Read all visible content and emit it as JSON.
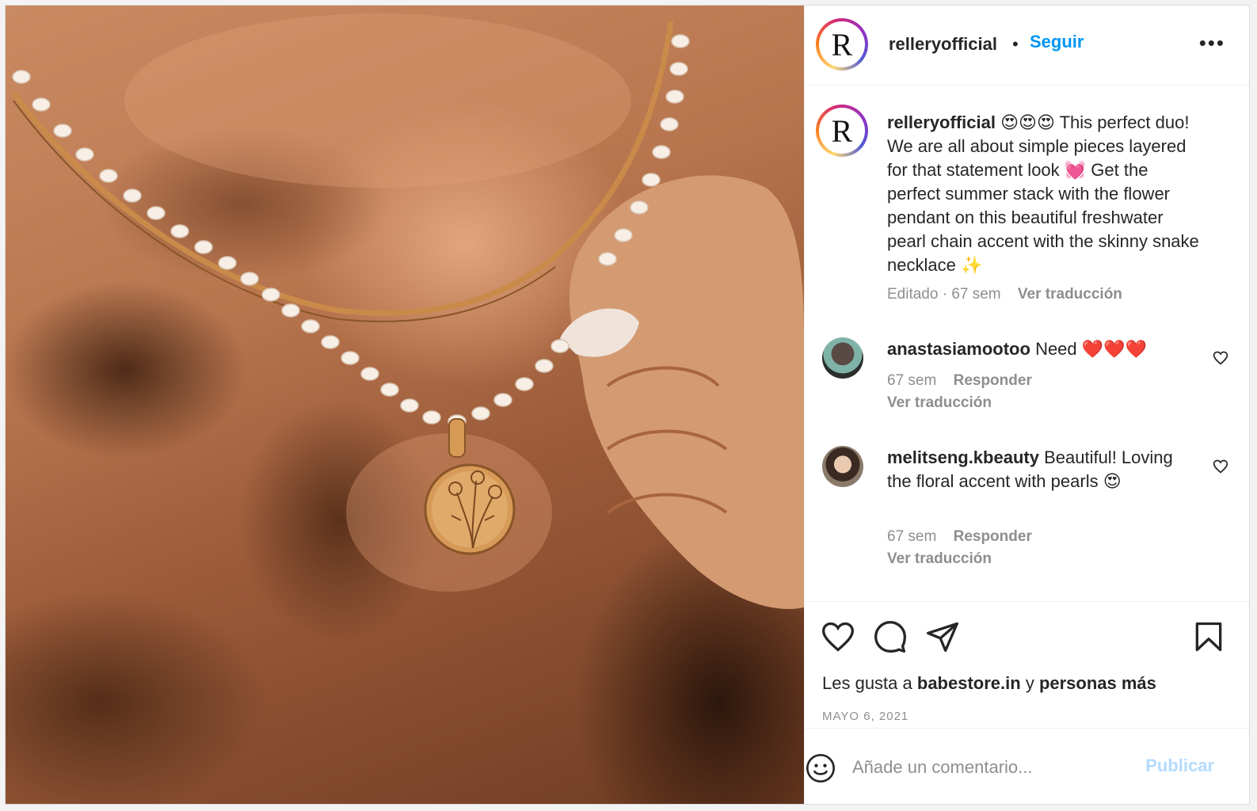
{
  "post": {
    "image_alt": "Woman wearing layered pearl and gold snake chain necklaces with floral pendant"
  },
  "header": {
    "avatar_letter": "R",
    "username": "relleryofficial",
    "separator": "•",
    "follow_label": "Seguir",
    "more_label": "•••"
  },
  "caption": {
    "avatar_letter": "R",
    "username": "relleryofficial",
    "emojis": "😍😍😍",
    "text": "This perfect duo! We are all about simple pieces layered for that statement look 💓 Get the perfect summer stack with the flower pendant on this beautiful freshwater pearl chain accent with the skinny snake necklace ✨",
    "edited_time": "Editado · 67 sem",
    "translate": "Ver traducción"
  },
  "comments": [
    {
      "username": "anastasiamootoo",
      "text": "Need ❤️❤️❤️",
      "time": "67 sem",
      "reply": "Responder",
      "translate": "Ver traducción"
    },
    {
      "username": "melitseng.kbeauty",
      "text": "Beautiful! Loving the floral accent with pearls 😍",
      "time": "67 sem",
      "reply": "Responder",
      "translate": "Ver traducción"
    }
  ],
  "likes": {
    "prefix": "Les gusta a",
    "user": "babestore.in",
    "conjunction": "y",
    "others": "personas más"
  },
  "date": "MAYO 6, 2021",
  "add_comment": {
    "placeholder": "Añade un comentario...",
    "publish_label": "Publicar"
  },
  "colors": {
    "accent": "#0095f6",
    "publish_disabled": "#b3dbff",
    "muted": "#8e8e8e",
    "text": "#262626"
  }
}
